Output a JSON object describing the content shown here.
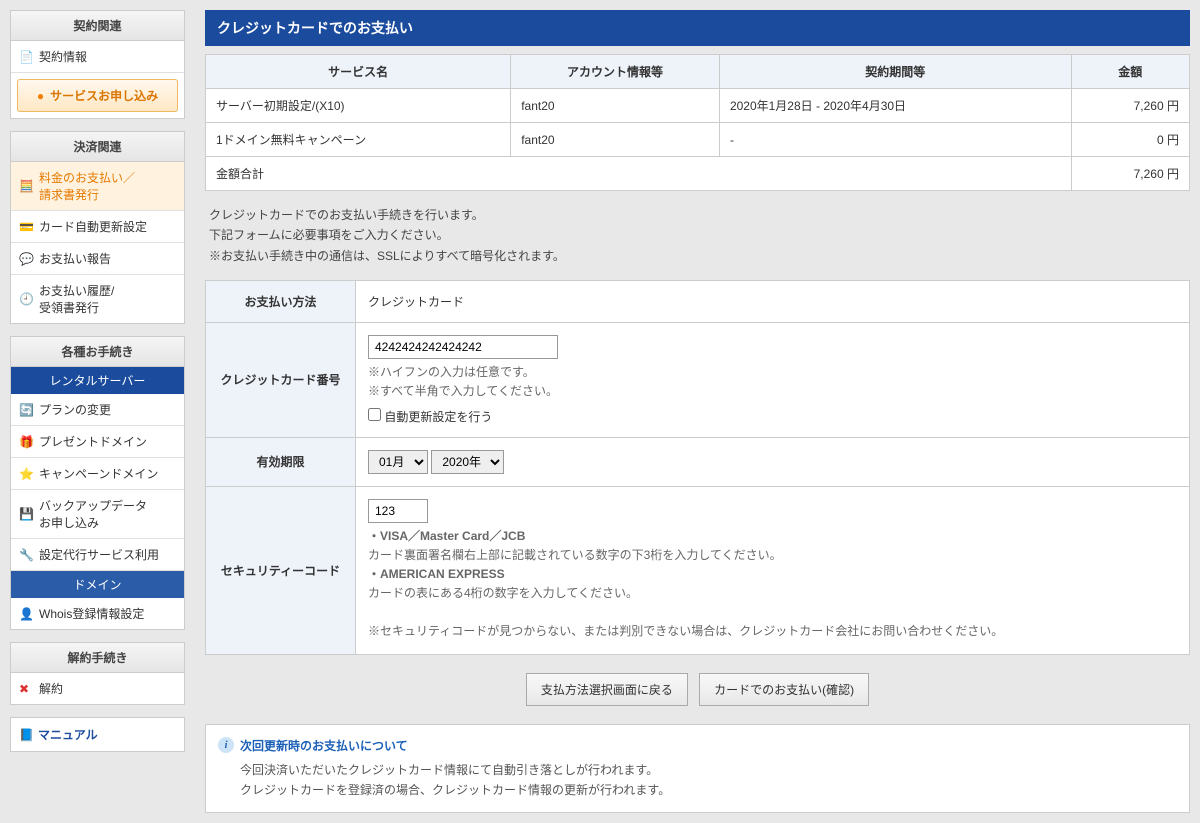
{
  "sidebar": {
    "contract": {
      "title": "契約関連",
      "items": [
        "契約情報"
      ],
      "apply_btn": "サービスお申し込み"
    },
    "payment": {
      "title": "決済関連",
      "items": [
        "料金のお支払い／\n請求書発行",
        "カード自動更新設定",
        "お支払い報告",
        "お支払い履歴/\n受領書発行"
      ]
    },
    "procedures": {
      "title": "各種お手続き",
      "rental_header": "レンタルサーバー",
      "rental_items": [
        "プランの変更",
        "プレゼントドメイン",
        "キャンペーンドメイン",
        "バックアップデータ\nお申し込み",
        "設定代行サービス利用"
      ],
      "domain_header": "ドメイン",
      "domain_items": [
        "Whois登録情報設定"
      ]
    },
    "cancel": {
      "title": "解約手続き",
      "items": [
        "解約"
      ]
    },
    "manual": "マニュアル"
  },
  "page_title": "クレジットカードでのお支払い",
  "order_table": {
    "headers": [
      "サービス名",
      "アカウント情報等",
      "契約期間等",
      "金額"
    ],
    "rows": [
      {
        "c": [
          "サーバー初期設定/(X10)",
          "fant20",
          "2020年1月28日 - 2020年4月30日",
          "7,260 円"
        ]
      },
      {
        "c": [
          "1ドメイン無料キャンペーン",
          "fant20",
          "-",
          "0 円"
        ]
      }
    ],
    "total_label": "金額合計",
    "total_value": "7,260 円"
  },
  "description": {
    "l1": "クレジットカードでのお支払い手続きを行います。",
    "l2": "下記フォームに必要事項をご入力ください。",
    "l3": "※お支払い手続き中の通信は、SSLによりすべて暗号化されます。"
  },
  "form": {
    "method_label": "お支払い方法",
    "method_value": "クレジットカード",
    "card_label": "クレジットカード番号",
    "card_value": "4242424242424242",
    "card_hint1": "※ハイフンの入力は任意です。",
    "card_hint2": "※すべて半角で入力してください。",
    "auto_renew": "自動更新設定を行う",
    "expiry_label": "有効期限",
    "expiry_month": "01月",
    "expiry_year": "2020年",
    "sec_label": "セキュリティーコード",
    "sec_value": "123",
    "sec_visa": "・VISA／Master Card／JCB",
    "sec_visa_desc": "カード裏面署名欄右上部に記載されている数字の下3桁を入力してください。",
    "sec_amex": "・AMERICAN EXPRESS",
    "sec_amex_desc": "カードの表にある4桁の数字を入力してください。",
    "sec_note": "※セキュリティコードが見つからない、または判別できない場合は、クレジットカード会社にお問い合わせください。"
  },
  "buttons": {
    "back": "支払方法選択画面に戻る",
    "confirm": "カードでのお支払い(確認)"
  },
  "info": {
    "title": "次回更新時のお支払いについて",
    "l1": "今回決済いただいたクレジットカード情報にて自動引き落としが行われます。",
    "l2": "クレジットカードを登録済の場合、クレジットカード情報の更新が行われます。"
  }
}
